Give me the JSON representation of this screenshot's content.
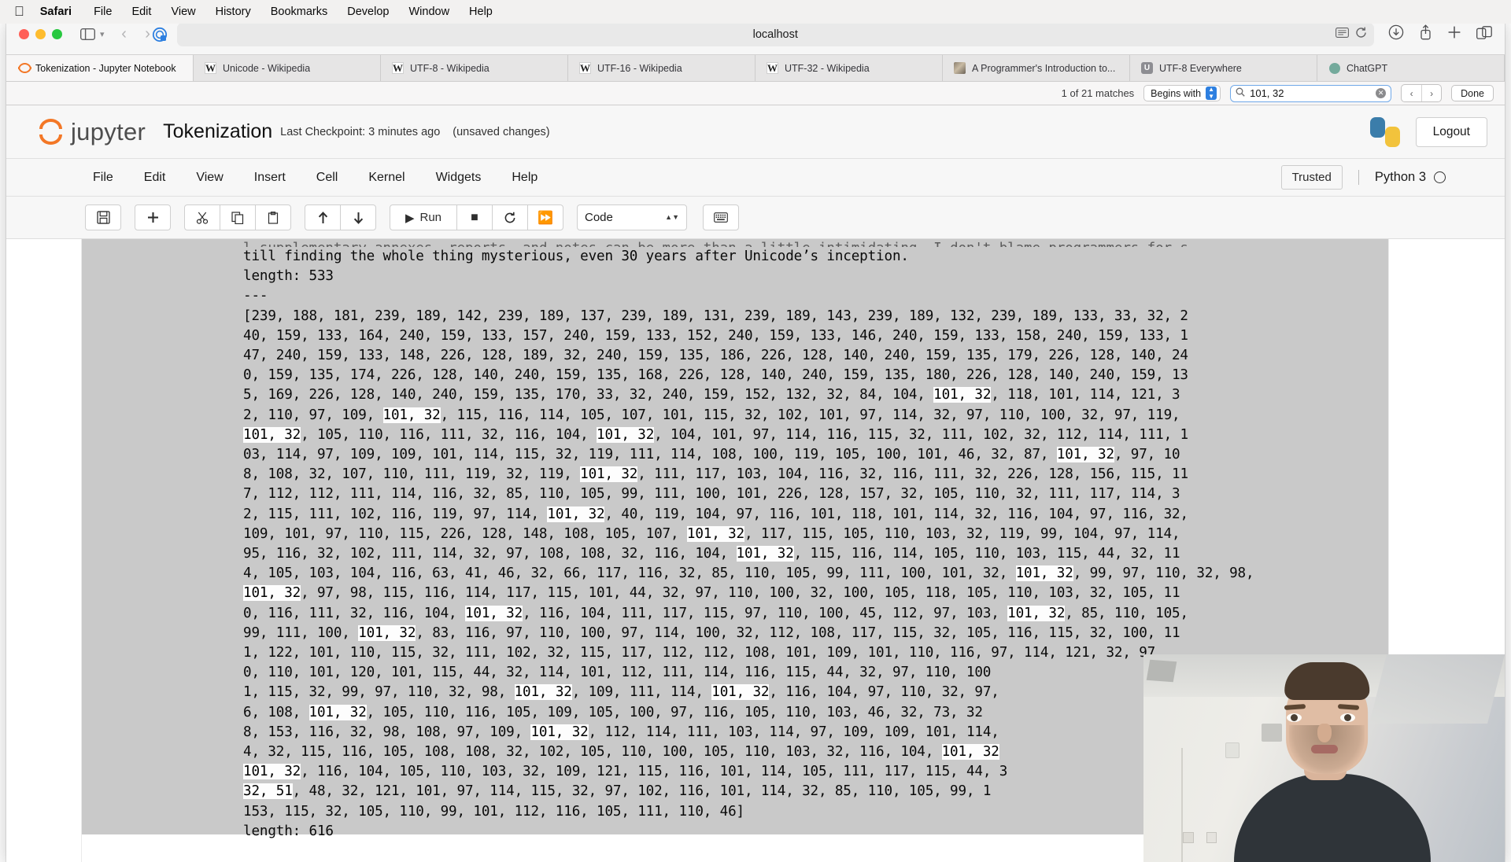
{
  "os_menubar": {
    "apple_icon": "apple-icon",
    "items": [
      {
        "label": "Safari",
        "bold": true
      },
      {
        "label": "File",
        "bold": false
      },
      {
        "label": "Edit",
        "bold": false
      },
      {
        "label": "View",
        "bold": false
      },
      {
        "label": "History",
        "bold": false
      },
      {
        "label": "Bookmarks",
        "bold": false
      },
      {
        "label": "Develop",
        "bold": false
      },
      {
        "label": "Window",
        "bold": false
      },
      {
        "label": "Help",
        "bold": false
      }
    ]
  },
  "browser": {
    "address": "localhost",
    "sidebar_icon": "sidebar-toggle-icon",
    "chevron_icon": "chevron-down-icon",
    "back_icon": "back-arrow-icon",
    "forward_icon": "forward-arrow-icon",
    "shield_icon": "privacy-shield-icon",
    "reader_icon": "reader-view-icon",
    "reload_icon": "reload-icon",
    "download_icon": "download-icon",
    "share_icon": "share-icon",
    "newtab_icon": "new-tab-icon",
    "tabs_overview_icon": "tab-overview-icon",
    "tabs": [
      {
        "label": "Tokenization - Jupyter Notebook",
        "favicon": "jupyter-favicon",
        "active": true
      },
      {
        "label": "Unicode - Wikipedia",
        "favicon": "wikipedia-favicon",
        "active": false
      },
      {
        "label": "UTF-8 - Wikipedia",
        "favicon": "wikipedia-favicon",
        "active": false
      },
      {
        "label": "UTF-16 - Wikipedia",
        "favicon": "wikipedia-favicon",
        "active": false
      },
      {
        "label": "UTF-32 - Wikipedia",
        "favicon": "wikipedia-favicon",
        "active": false
      },
      {
        "label": "A Programmer's Introduction to...",
        "favicon": "article-favicon",
        "active": false
      },
      {
        "label": "UTF-8 Everywhere",
        "favicon": "utf8everywhere-favicon",
        "active": false
      },
      {
        "label": "ChatGPT",
        "favicon": "chatgpt-favicon",
        "active": false
      }
    ],
    "findbar": {
      "match_count": "1 of 21 matches",
      "mode_label": "Begins with",
      "stepper_icon": "stepper-up-down-icon",
      "search_icon": "search-icon",
      "query": "101, 32",
      "clear_icon": "clear-icon",
      "prev_icon": "previous-match-icon",
      "next_icon": "next-match-icon",
      "done_label": "Done"
    }
  },
  "jupyter": {
    "logo_text": "jupyter",
    "logo_icon": "jupyter-logo-icon",
    "notebook_name": "Tokenization",
    "checkpoint": "Last Checkpoint: 3 minutes ago",
    "dirty_state": "(unsaved changes)",
    "python_logo_icon": "python-logo-icon",
    "logout_label": "Logout",
    "menu": [
      "File",
      "Edit",
      "View",
      "Insert",
      "Cell",
      "Kernel",
      "Widgets",
      "Help"
    ],
    "trusted_label": "Trusted",
    "kernel_label": "Python 3",
    "kernel_status_icon": "kernel-idle-circle-icon",
    "toolbar": {
      "save_icon": "save-icon",
      "add_icon": "add-cell-icon",
      "cut_icon": "cut-icon",
      "copy_icon": "copy-icon",
      "paste_icon": "paste-icon",
      "up_icon": "move-up-icon",
      "down_icon": "move-down-icon",
      "run_icon": "run-icon",
      "run_label": "Run",
      "stop_icon": "stop-icon",
      "restart_icon": "restart-icon",
      "fastforward_icon": "restart-run-all-icon",
      "cell_type": "Code",
      "cell_type_caret_icon": "select-caret-icon",
      "keyboard_icon": "command-palette-icon"
    }
  },
  "output": {
    "highlight_token": "101, 32",
    "clipped_top_line": "l supplementary annexes, reports, and notes can be more than a little intimidating. I don't blame programmers for s",
    "lines": [
      "till finding the whole thing mysterious, even 30 years after Unicode’s inception.",
      "length: 533",
      "---",
      "[239, 188, 181, 239, 189, 142, 239, 189, 137, 239, 189, 131, 239, 189, 143, 239, 189, 132, 239, 189, 133, 33, 32, 2",
      "40, 159, 133, 164, 240, 159, 133, 157, 240, 159, 133, 152, 240, 159, 133, 146, 240, 159, 133, 158, 240, 159, 133, 1",
      "47, 240, 159, 133, 148, 226, 128, 189, 32, 240, 159, 135, 186, 226, 128, 140, 240, 159, 135, 179, 226, 128, 140, 24",
      "0, 159, 135, 174, 226, 128, 140, 240, 159, 135, 168, 226, 128, 140, 240, 159, 135, 180, 226, 128, 140, 240, 159, 13",
      "5, 169, 226, 128, 140, 240, 159, 135, 170, 33, 32, 240, 159, 152, 132, 32, 84, 104, {H}, 118, 101, 114, 121, 3",
      "2, 110, 97, 109, {H}, 115, 116, 114, 105, 107, 101, 115, 32, 102, 101, 97, 114, 32, 97, 110, 100, 32, 97, 119,",
      "{H}, 105, 110, 116, 111, 32, 116, 104, {H}, 104, 101, 97, 114, 116, 115, 32, 111, 102, 32, 112, 114, 111, 1",
      "03, 114, 97, 109, 109, 101, 114, 115, 32, 119, 111, 114, 108, 100, 119, 105, 100, 101, 46, 32, 87, {H}, 97, 10",
      "8, 108, 32, 107, 110, 111, 119, 32, 119, {H}, 111, 117, 103, 104, 116, 32, 116, 111, 32, 226, 128, 156, 115, 11",
      "7, 112, 112, 111, 114, 116, 32, 85, 110, 105, 99, 111, 100, 101, 226, 128, 157, 32, 105, 110, 32, 111, 117, 114, 3",
      "2, 115, 111, 102, 116, 119, 97, 114, {H}, 40, 119, 104, 97, 116, 101, 118, 101, 114, 32, 116, 104, 97, 116, 32,",
      "109, 101, 97, 110, 115, 226, 128, 148, 108, 105, 107, {H}, 117, 115, 105, 110, 103, 32, 119, 99, 104, 97, 114,",
      "95, 116, 32, 102, 111, 114, 32, 97, 108, 108, 32, 116, 104, {H}, 115, 116, 114, 105, 110, 103, 115, 44, 32, 11",
      "4, 105, 103, 104, 116, 63, 41, 46, 32, 66, 117, 116, 32, 85, 110, 105, 99, 111, 100, 101, 32, {H}, 99, 97, 110, 32, 98,",
      "{H}, 97, 98, 115, 116, 114, 117, 115, 101, 44, 32, 97, 110, 100, 32, 100, 105, 118, 105, 110, 103, 32, 105, 11",
      "0, 116, 111, 32, 116, 104, {H}, 116, 104, 111, 117, 115, 97, 110, 100, 45, 112, 97, 103, {H}, 85, 110, 105,",
      "99, 111, 100, {H}, 83, 116, 97, 110, 100, 97, 114, 100, 32, 112, 108, 117, 115, 32, 105, 116, 115, 32, 100, 11",
      "1, 122, 101, 110, 115, 32, 111, 102, 32, 115, 117, 112, 112, 108, 101, 109, 101, 110, 116, 97, 114, 121, 32, 97",
      "0, 110, 101, 120, 101, 115, 44, 32, 114, 101, 112, 111, 114, 116, 115, 44, 32, 97, 110, 100",
      "1, 115, 32, 99, 97, 110, 32, 98, {H}, 109, 111, 114, {H}, 116, 104, 97, 110, 32, 97,",
      "6, 108, {H}, 105, 110, 116, 105, 109, 105, 100, 97, 116, 105, 110, 103, 46, 32, 73, 32",
      "8, 153, 116, 32, 98, 108, 97, 109, {H}, 112, 114, 111, 103, 114, 97, 109, 109, 101, 114,",
      "4, 32, 115, 116, 105, 108, 108, 32, 102, 105, 110, 100, 105, 110, 103, 32, 116, 104, {H}",
      "{H}, 116, 104, 105, 110, 103, 32, 109, 121, 115, 116, 101, 114, 105, 111, 117, 115, 44, 3",
      "32, 51, 48, 32, 121, 101, 97, 114, 115, 32, 97, 102, 116, 101, 114, 32, 85, 110, 105, 99, 1",
      "153, 115, 32, 105, 110, 99, 101, 112, 116, 105, 111, 110, 46]",
      "length: 616"
    ],
    "first_highlight_prefix_line_index": 27,
    "partial_highlight_line_text": "01, 32"
  },
  "webcam": {
    "description": "webcam-overlay"
  },
  "colors": {
    "jupyter_orange": "#f37726",
    "accent_blue": "#2d7fe0",
    "output_bg": "#c9c9c9",
    "highlight_bg": "#fdfdfd"
  }
}
